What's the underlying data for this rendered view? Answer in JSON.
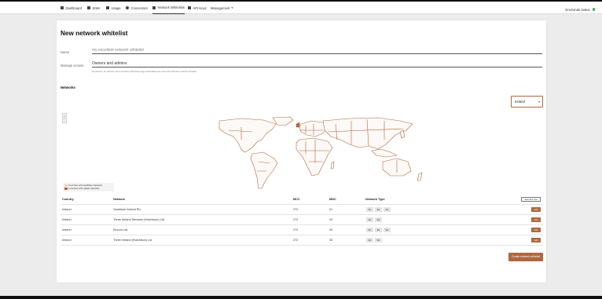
{
  "nav": {
    "items": [
      {
        "label": "Dashboard",
        "icon": "dashboard-icon"
      },
      {
        "label": "SIMs",
        "icon": "sim-icon"
      },
      {
        "label": "Usage",
        "icon": "usage-icon"
      },
      {
        "label": "Connectors",
        "icon": "connectors-icon"
      },
      {
        "label": "Network Whitelists",
        "icon": "network-icon"
      },
      {
        "label": "API Keys",
        "icon": "key-icon"
      },
      {
        "label": "Management",
        "icon": "chevron-down-icon"
      }
    ],
    "status": "Environde status"
  },
  "form": {
    "title": "New network whitelist",
    "name_label": "Name",
    "name_placeholder": "my excellent network whitelist",
    "manage_label": "Manage access",
    "manage_value": "Owners and admins",
    "manage_hint": "All owners, an admins, and members with those tags associated can view and edit this network whitelist"
  },
  "networks": {
    "section_label": "Networks",
    "country_select": "Ireland",
    "zoom_in": "+",
    "zoom_out": "−",
    "legend": [
      {
        "label": "Countries with available networks",
        "color": "#e8d2c2"
      },
      {
        "label": "Countries with added networks",
        "color": "#b0673f"
      }
    ]
  },
  "table": {
    "headers": {
      "country": "Country",
      "network": "Network",
      "mcc": "MCC",
      "mnc": "MNC",
      "type": "Network Type"
    },
    "add_all_label": "Add all in list",
    "add_label": "Add",
    "rows": [
      {
        "country": "Ireland",
        "network": "Vodafone Ireland Plc",
        "mcc": "272",
        "mnc": "01",
        "types": [
          "2G",
          "3G",
          "4G"
        ]
      },
      {
        "country": "Ireland",
        "network": "Three Ireland Services (Hutchison) Ltd",
        "mcc": "272",
        "mnc": "02",
        "types": [
          "2G",
          "3G"
        ]
      },
      {
        "country": "Ireland",
        "network": "Eircom Ltd",
        "mcc": "272",
        "mnc": "03",
        "types": [
          "2G",
          "3G",
          "4G"
        ]
      },
      {
        "country": "Ireland",
        "network": "Three Ireland (Hutchison) Ltd",
        "mcc": "272",
        "mnc": "05",
        "types": [
          "2G",
          "3G"
        ]
      }
    ]
  },
  "create_label": "Create network whitelist",
  "colors": {
    "accent": "#b0673f",
    "status_ok": "#3cb04a"
  }
}
